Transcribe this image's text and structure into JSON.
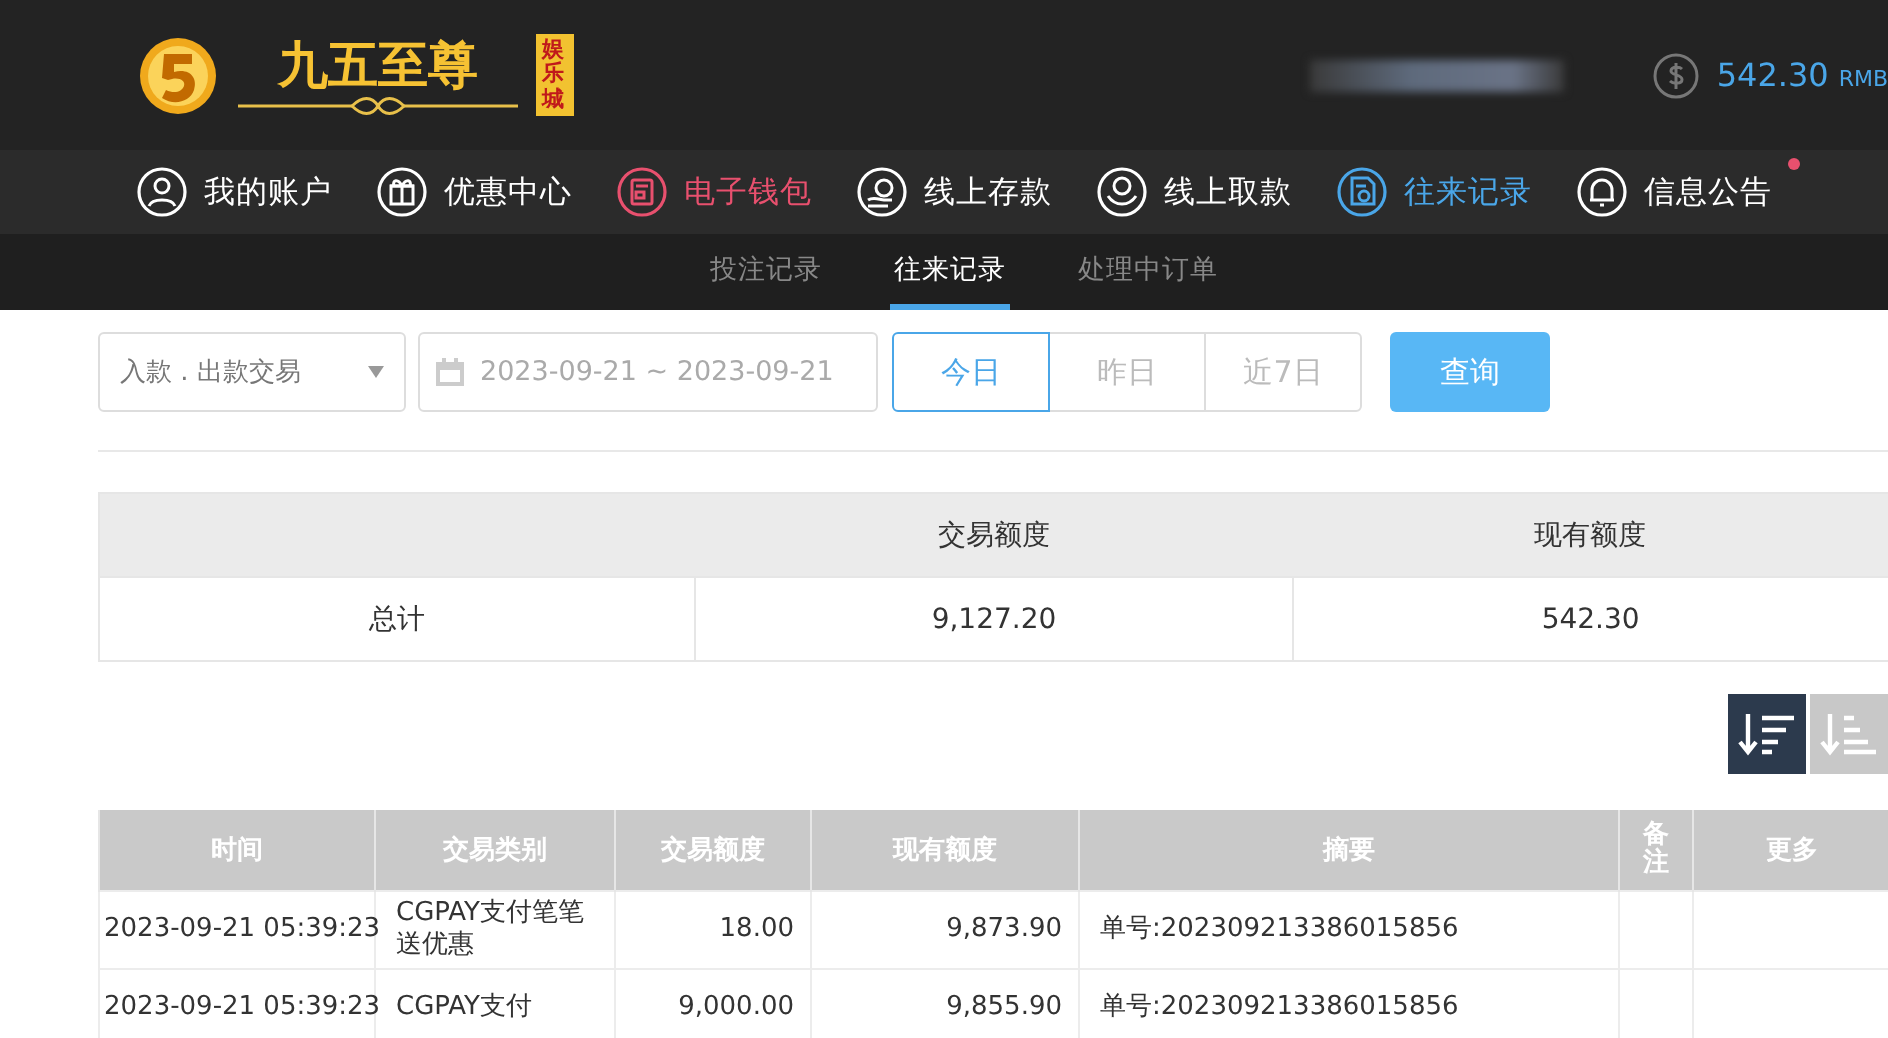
{
  "logo": {
    "name": "九五至尊",
    "tag": "娱乐城"
  },
  "balance": {
    "amount": "542.30",
    "currency": "RMB"
  },
  "nav": [
    {
      "label": "我的账户",
      "color": "#ffffff",
      "badge": false
    },
    {
      "label": "优惠中心",
      "color": "#ffffff",
      "badge": false
    },
    {
      "label": "电子钱包",
      "color": "#e8506e",
      "badge": false
    },
    {
      "label": "线上存款",
      "color": "#ffffff",
      "badge": false
    },
    {
      "label": "线上取款",
      "color": "#ffffff",
      "badge": false
    },
    {
      "label": "往来记录",
      "color": "#4aa6e8",
      "badge": false
    },
    {
      "label": "信息公告",
      "color": "#ffffff",
      "badge": true
    }
  ],
  "subtabs": [
    {
      "label": "投注记录",
      "selected": false
    },
    {
      "label": "往来记录",
      "selected": true
    },
    {
      "label": "处理中订单",
      "selected": false
    }
  ],
  "filter": {
    "type": "入款 . 出款交易",
    "date_range": "2023-09-21 ~ 2023-09-21",
    "ranges": [
      {
        "label": "今日",
        "selected": true
      },
      {
        "label": "昨日",
        "selected": false
      },
      {
        "label": "近7日",
        "selected": false
      }
    ],
    "query": "查询"
  },
  "summary": {
    "columns": [
      "交易额度",
      "现有额度"
    ],
    "row": [
      "总计",
      "9,127.20",
      "542.30"
    ]
  },
  "sort": [
    {
      "kind": "desc",
      "selected": true
    },
    {
      "kind": "asc",
      "selected": false
    }
  ],
  "table": {
    "columns": [
      "时间",
      "交易类别",
      "交易额度",
      "现有额度",
      "摘要",
      "备注",
      "更多"
    ],
    "rows": [
      [
        "2023-09-21 05:39:23",
        "CGPAY支付笔笔送优惠",
        "18.00",
        "9,873.90",
        "单号:202309213386015856"
      ],
      [
        "2023-09-21 05:39:23",
        "CGPAY支付",
        "9,000.00",
        "9,855.90",
        "单号:202309213386015856"
      ]
    ]
  }
}
